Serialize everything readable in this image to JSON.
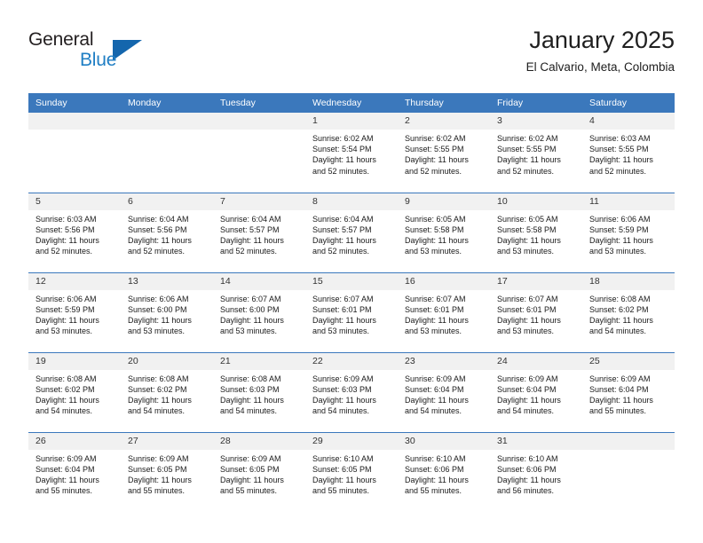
{
  "logo": {
    "word1": "General",
    "word2": "Blue",
    "triangle_color": "#1466ad",
    "blue_text_color": "#1f7ec4"
  },
  "header": {
    "title": "January 2025",
    "subtitle": "El Calvario, Meta, Colombia"
  },
  "theme": {
    "header_row_bg": "#3b78bc",
    "daynum_bg": "#f1f1f1",
    "grid_line": "#3b78bc"
  },
  "weekday_headers": [
    "Sunday",
    "Monday",
    "Tuesday",
    "Wednesday",
    "Thursday",
    "Friday",
    "Saturday"
  ],
  "labels": {
    "sunrise_prefix": "Sunrise: ",
    "sunset_prefix": "Sunset: ",
    "daylight_prefix": "Daylight: "
  },
  "weeks": [
    [
      {
        "empty": true
      },
      {
        "empty": true
      },
      {
        "empty": true
      },
      {
        "day": "1",
        "sunrise": "Sunrise: 6:02 AM",
        "sunset": "Sunset: 5:54 PM",
        "daylight_1": "Daylight: 11 hours",
        "daylight_2": "and 52 minutes."
      },
      {
        "day": "2",
        "sunrise": "Sunrise: 6:02 AM",
        "sunset": "Sunset: 5:55 PM",
        "daylight_1": "Daylight: 11 hours",
        "daylight_2": "and 52 minutes."
      },
      {
        "day": "3",
        "sunrise": "Sunrise: 6:02 AM",
        "sunset": "Sunset: 5:55 PM",
        "daylight_1": "Daylight: 11 hours",
        "daylight_2": "and 52 minutes."
      },
      {
        "day": "4",
        "sunrise": "Sunrise: 6:03 AM",
        "sunset": "Sunset: 5:55 PM",
        "daylight_1": "Daylight: 11 hours",
        "daylight_2": "and 52 minutes."
      }
    ],
    [
      {
        "day": "5",
        "sunrise": "Sunrise: 6:03 AM",
        "sunset": "Sunset: 5:56 PM",
        "daylight_1": "Daylight: 11 hours",
        "daylight_2": "and 52 minutes."
      },
      {
        "day": "6",
        "sunrise": "Sunrise: 6:04 AM",
        "sunset": "Sunset: 5:56 PM",
        "daylight_1": "Daylight: 11 hours",
        "daylight_2": "and 52 minutes."
      },
      {
        "day": "7",
        "sunrise": "Sunrise: 6:04 AM",
        "sunset": "Sunset: 5:57 PM",
        "daylight_1": "Daylight: 11 hours",
        "daylight_2": "and 52 minutes."
      },
      {
        "day": "8",
        "sunrise": "Sunrise: 6:04 AM",
        "sunset": "Sunset: 5:57 PM",
        "daylight_1": "Daylight: 11 hours",
        "daylight_2": "and 52 minutes."
      },
      {
        "day": "9",
        "sunrise": "Sunrise: 6:05 AM",
        "sunset": "Sunset: 5:58 PM",
        "daylight_1": "Daylight: 11 hours",
        "daylight_2": "and 53 minutes."
      },
      {
        "day": "10",
        "sunrise": "Sunrise: 6:05 AM",
        "sunset": "Sunset: 5:58 PM",
        "daylight_1": "Daylight: 11 hours",
        "daylight_2": "and 53 minutes."
      },
      {
        "day": "11",
        "sunrise": "Sunrise: 6:06 AM",
        "sunset": "Sunset: 5:59 PM",
        "daylight_1": "Daylight: 11 hours",
        "daylight_2": "and 53 minutes."
      }
    ],
    [
      {
        "day": "12",
        "sunrise": "Sunrise: 6:06 AM",
        "sunset": "Sunset: 5:59 PM",
        "daylight_1": "Daylight: 11 hours",
        "daylight_2": "and 53 minutes."
      },
      {
        "day": "13",
        "sunrise": "Sunrise: 6:06 AM",
        "sunset": "Sunset: 6:00 PM",
        "daylight_1": "Daylight: 11 hours",
        "daylight_2": "and 53 minutes."
      },
      {
        "day": "14",
        "sunrise": "Sunrise: 6:07 AM",
        "sunset": "Sunset: 6:00 PM",
        "daylight_1": "Daylight: 11 hours",
        "daylight_2": "and 53 minutes."
      },
      {
        "day": "15",
        "sunrise": "Sunrise: 6:07 AM",
        "sunset": "Sunset: 6:01 PM",
        "daylight_1": "Daylight: 11 hours",
        "daylight_2": "and 53 minutes."
      },
      {
        "day": "16",
        "sunrise": "Sunrise: 6:07 AM",
        "sunset": "Sunset: 6:01 PM",
        "daylight_1": "Daylight: 11 hours",
        "daylight_2": "and 53 minutes."
      },
      {
        "day": "17",
        "sunrise": "Sunrise: 6:07 AM",
        "sunset": "Sunset: 6:01 PM",
        "daylight_1": "Daylight: 11 hours",
        "daylight_2": "and 53 minutes."
      },
      {
        "day": "18",
        "sunrise": "Sunrise: 6:08 AM",
        "sunset": "Sunset: 6:02 PM",
        "daylight_1": "Daylight: 11 hours",
        "daylight_2": "and 54 minutes."
      }
    ],
    [
      {
        "day": "19",
        "sunrise": "Sunrise: 6:08 AM",
        "sunset": "Sunset: 6:02 PM",
        "daylight_1": "Daylight: 11 hours",
        "daylight_2": "and 54 minutes."
      },
      {
        "day": "20",
        "sunrise": "Sunrise: 6:08 AM",
        "sunset": "Sunset: 6:02 PM",
        "daylight_1": "Daylight: 11 hours",
        "daylight_2": "and 54 minutes."
      },
      {
        "day": "21",
        "sunrise": "Sunrise: 6:08 AM",
        "sunset": "Sunset: 6:03 PM",
        "daylight_1": "Daylight: 11 hours",
        "daylight_2": "and 54 minutes."
      },
      {
        "day": "22",
        "sunrise": "Sunrise: 6:09 AM",
        "sunset": "Sunset: 6:03 PM",
        "daylight_1": "Daylight: 11 hours",
        "daylight_2": "and 54 minutes."
      },
      {
        "day": "23",
        "sunrise": "Sunrise: 6:09 AM",
        "sunset": "Sunset: 6:04 PM",
        "daylight_1": "Daylight: 11 hours",
        "daylight_2": "and 54 minutes."
      },
      {
        "day": "24",
        "sunrise": "Sunrise: 6:09 AM",
        "sunset": "Sunset: 6:04 PM",
        "daylight_1": "Daylight: 11 hours",
        "daylight_2": "and 54 minutes."
      },
      {
        "day": "25",
        "sunrise": "Sunrise: 6:09 AM",
        "sunset": "Sunset: 6:04 PM",
        "daylight_1": "Daylight: 11 hours",
        "daylight_2": "and 55 minutes."
      }
    ],
    [
      {
        "day": "26",
        "sunrise": "Sunrise: 6:09 AM",
        "sunset": "Sunset: 6:04 PM",
        "daylight_1": "Daylight: 11 hours",
        "daylight_2": "and 55 minutes."
      },
      {
        "day": "27",
        "sunrise": "Sunrise: 6:09 AM",
        "sunset": "Sunset: 6:05 PM",
        "daylight_1": "Daylight: 11 hours",
        "daylight_2": "and 55 minutes."
      },
      {
        "day": "28",
        "sunrise": "Sunrise: 6:09 AM",
        "sunset": "Sunset: 6:05 PM",
        "daylight_1": "Daylight: 11 hours",
        "daylight_2": "and 55 minutes."
      },
      {
        "day": "29",
        "sunrise": "Sunrise: 6:10 AM",
        "sunset": "Sunset: 6:05 PM",
        "daylight_1": "Daylight: 11 hours",
        "daylight_2": "and 55 minutes."
      },
      {
        "day": "30",
        "sunrise": "Sunrise: 6:10 AM",
        "sunset": "Sunset: 6:06 PM",
        "daylight_1": "Daylight: 11 hours",
        "daylight_2": "and 55 minutes."
      },
      {
        "day": "31",
        "sunrise": "Sunrise: 6:10 AM",
        "sunset": "Sunset: 6:06 PM",
        "daylight_1": "Daylight: 11 hours",
        "daylight_2": "and 56 minutes."
      },
      {
        "empty": true
      }
    ]
  ]
}
